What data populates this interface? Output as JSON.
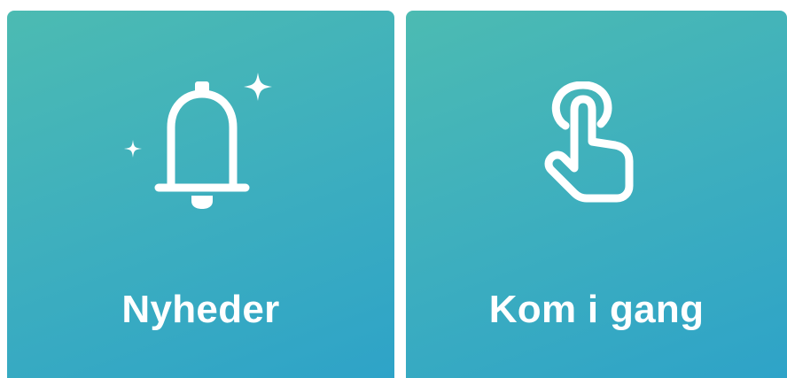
{
  "tiles": [
    {
      "label": "Nyheder",
      "icon": "bell-with-sparkles-icon"
    },
    {
      "label": "Kom i gang",
      "icon": "tap-hand-icon"
    }
  ],
  "colors": {
    "tile_gradient_start": "#4cbbb2",
    "tile_gradient_end": "#2ea3c8",
    "foreground": "#ffffff"
  }
}
